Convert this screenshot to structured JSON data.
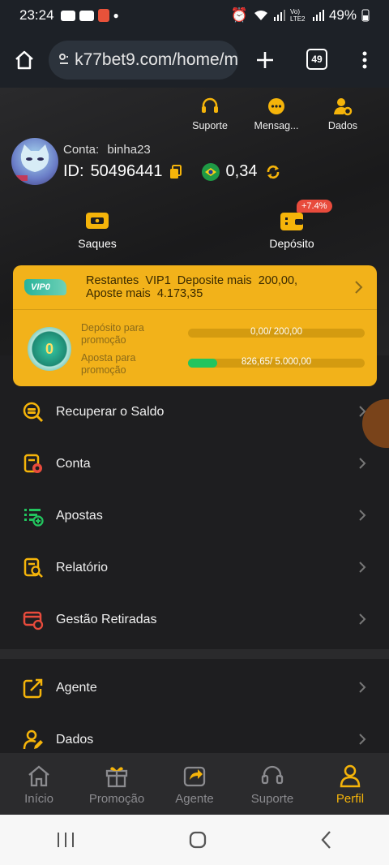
{
  "status_bar": {
    "time": "23:24",
    "network_label": "Vo) LTE2",
    "battery": "49%"
  },
  "browser": {
    "url": "k77bet9.com/home/m",
    "tab_count": "49"
  },
  "header": {
    "top_icons": [
      {
        "label": "Suporte",
        "icon": "headset-icon"
      },
      {
        "label": "Mensag...",
        "icon": "message-icon"
      },
      {
        "label": "Dados",
        "icon": "user-gear-icon"
      }
    ],
    "account_label": "Conta:",
    "account_name": "binha23",
    "id_label": "ID:",
    "id_value": "50496441",
    "balance": "0,34"
  },
  "actions": {
    "withdraw": "Saques",
    "deposit": "Depósito",
    "deposit_badge": "+7.4%"
  },
  "vip": {
    "badge": "VIP0",
    "line1_a": "Restantes",
    "line1_b": "VIP1",
    "line1_c": "Deposite mais",
    "line1_d": "200,00,",
    "line2_a": "Aposte mais",
    "line2_b": "4.173,35",
    "coin_level": "0",
    "deposit_label": "Depósito para promoção",
    "deposit_progress": "0,00/ 200,00",
    "deposit_fraction": 0,
    "bet_label": "Aposta para promoção",
    "bet_progress": "826,65/ 5.000,00",
    "bet_fraction": 0.165
  },
  "menu": [
    {
      "label": "Recuperar o Saldo",
      "icon": "coin-search-icon"
    },
    {
      "label": "Conta",
      "icon": "account-doc-icon"
    },
    {
      "label": "Apostas",
      "icon": "bets-list-icon"
    },
    {
      "label": "Relatório",
      "icon": "report-search-icon"
    },
    {
      "label": "Gestão Retiradas",
      "icon": "withdraw-card-icon"
    },
    {
      "label": "Agente",
      "icon": "share-out-icon"
    },
    {
      "label": "Dados",
      "icon": "user-edit-icon"
    }
  ],
  "tabs": [
    {
      "label": "Início",
      "icon": "home-icon"
    },
    {
      "label": "Promoção",
      "icon": "gift-icon"
    },
    {
      "label": "Agente",
      "icon": "share-icon"
    },
    {
      "label": "Suporte",
      "icon": "headset-icon"
    },
    {
      "label": "Perfil",
      "icon": "profile-icon",
      "active": true
    }
  ],
  "colors": {
    "accent": "#f5b40a",
    "vip_card": "#f2b21a",
    "progress_fill": "#22c55e",
    "danger": "#e84b3c"
  }
}
